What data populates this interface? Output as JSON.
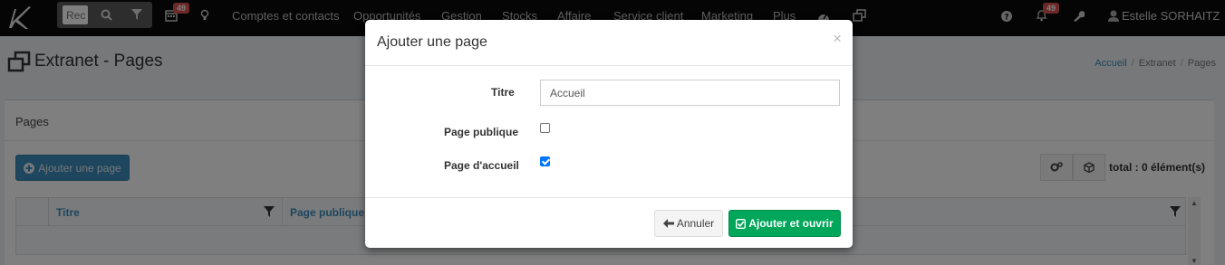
{
  "topnav": {
    "search_placeholder": "Rec",
    "calendar_badge": "49",
    "menu": [
      "Comptes et contacts",
      "Opportunités",
      "Gestion",
      "Stocks",
      "Affaire",
      "Service client",
      "Marketing",
      "Plus"
    ],
    "notif_badge": "49",
    "user_name": "Estelle SORHAITZ"
  },
  "page": {
    "title": "Extranet - Pages",
    "breadcrumb": [
      "Accueil",
      "Extranet",
      "Pages"
    ]
  },
  "box": {
    "title": "Pages",
    "add_button": "Ajouter une page",
    "total": "total : 0 élément(s)",
    "columns": [
      "Titre",
      "Page publique"
    ]
  },
  "modal": {
    "title": "Ajouter une page",
    "close": "×",
    "fields": {
      "titre_label": "Titre",
      "titre_value": "Accueil",
      "publique_label": "Page publique",
      "publique_checked": false,
      "accueil_label": "Page d'accueil",
      "accueil_checked": true
    },
    "cancel_label": "Annuler",
    "submit_label": "Ajouter et ouvrir"
  },
  "colors": {
    "navbar": "#0a0a0a",
    "primary": "#3c8dbc",
    "success": "#00a65a",
    "danger_badge": "#d9534f"
  }
}
